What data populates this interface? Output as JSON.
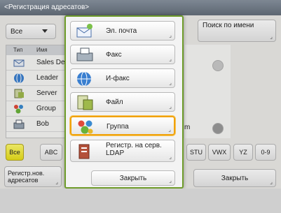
{
  "window": {
    "title": "<Регистрация адресатов>"
  },
  "filter": {
    "value": "Все"
  },
  "search_button": {
    "label": "Поиск по имени"
  },
  "table": {
    "headers": {
      "type": "Тип",
      "name": "Имя"
    },
    "rows": [
      {
        "name": "Sales De",
        "icon": "email-icon"
      },
      {
        "name": "Leader",
        "icon": "ifax-icon"
      },
      {
        "name": "Server",
        "icon": "file-server-icon"
      },
      {
        "name": "Group",
        "icon": "group-icon"
      },
      {
        "name": "Bob",
        "icon": "fax-icon"
      }
    ],
    "partial_right_text": "m"
  },
  "alpha_tabs": [
    "Все",
    "ABC",
    "STU",
    "VWX",
    "YZ",
    "0-9"
  ],
  "register_button": {
    "label": "Регистр.нов. адресатов"
  },
  "close_button": {
    "label": "Закрыть"
  },
  "popup_menu": {
    "items": [
      {
        "label": "Эл. почта",
        "icon": "email-icon"
      },
      {
        "label": "Факс",
        "icon": "fax-icon"
      },
      {
        "label": "И-факс",
        "icon": "ifax-icon"
      },
      {
        "label": "Файл",
        "icon": "file-server-icon"
      },
      {
        "label": "Группа",
        "icon": "group-icon",
        "selected": true
      },
      {
        "label": "Регистр. на серв. LDAP",
        "icon": "ldap-server-icon"
      }
    ],
    "close_label": "Закрыть"
  },
  "colors": {
    "highlight": "#f0a20a",
    "active_tab": "#f2e83a",
    "popup_border": "#6e9c2a",
    "titlebar": "#6b7480"
  }
}
